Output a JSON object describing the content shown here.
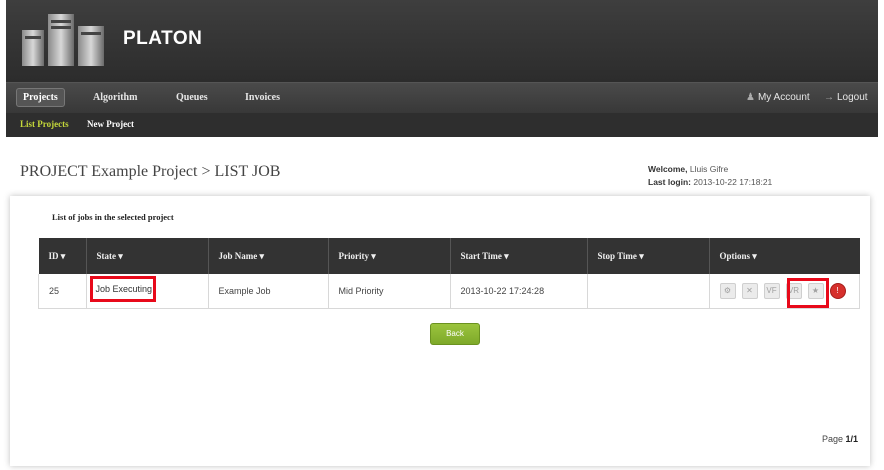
{
  "app": {
    "name": "PLATON"
  },
  "nav": {
    "items": [
      {
        "label": "Projects"
      },
      {
        "label": "Algorithm"
      },
      {
        "label": "Queues"
      },
      {
        "label": "Invoices"
      }
    ],
    "account_label": "My Account",
    "logout_label": "Logout"
  },
  "subnav": {
    "items": [
      {
        "label": "List Projects"
      },
      {
        "label": "New Project"
      }
    ]
  },
  "page": {
    "title": "PROJECT Example Project > LIST JOB"
  },
  "welcome": {
    "label": "Welcome,",
    "user": "Lluis Gifre",
    "last_login_label": "Last login:",
    "last_login_value": "2013-10-22 17:18:21"
  },
  "panel": {
    "caption": "List of jobs in the selected project"
  },
  "table": {
    "headers": [
      "ID",
      "State",
      "Job Name",
      "Priority",
      "Start Time",
      "Stop Time",
      "Options"
    ],
    "rows": [
      {
        "id": "25",
        "state": "Job Executing",
        "job_name": "Example Job",
        "priority": "Mid Priority",
        "start_time": "2013-10-22 17:24:28",
        "stop_time": ""
      }
    ],
    "options": [
      {
        "icon": "gear-icon",
        "glyph": "⚙"
      },
      {
        "icon": "close-icon",
        "glyph": "✕"
      },
      {
        "icon": "vf-icon",
        "glyph": "VF"
      },
      {
        "icon": "vr-icon",
        "glyph": "VR"
      },
      {
        "icon": "star-icon",
        "glyph": "★"
      },
      {
        "icon": "stop-icon",
        "glyph": "!"
      }
    ]
  },
  "back_label": "Back",
  "pager": {
    "label": "Page",
    "value": "1/1"
  },
  "colors": {
    "highlight": "#e8091a",
    "active_tab": "#c5d83a",
    "back_button": "#8bb534"
  }
}
